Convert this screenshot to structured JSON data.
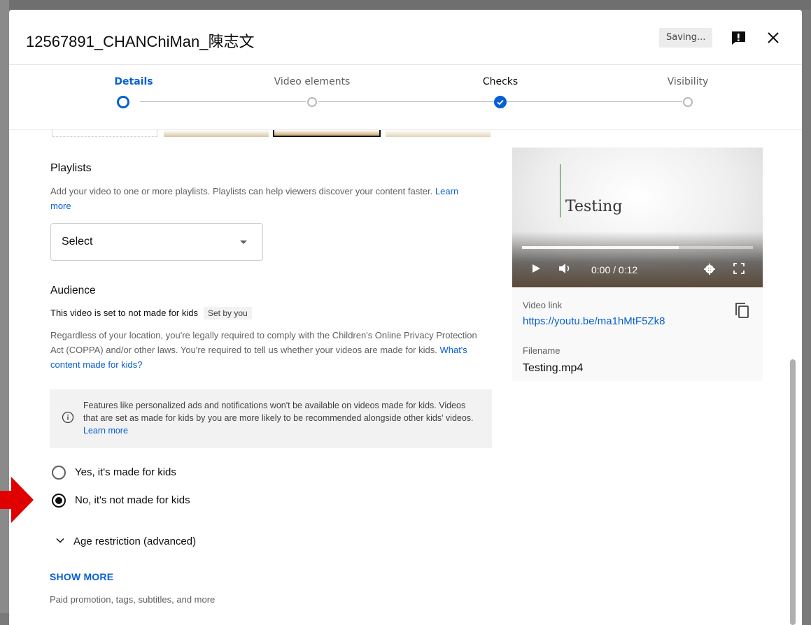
{
  "dialog": {
    "title": "12567891_CHANChiMan_陳志文",
    "saving_label": "Saving...",
    "feedback_icon": "feedback-icon",
    "close_icon": "close-icon"
  },
  "stepper": {
    "steps": [
      {
        "label": "Details",
        "state": "active"
      },
      {
        "label": "Video elements",
        "state": "todo"
      },
      {
        "label": "Checks",
        "state": "done"
      },
      {
        "label": "Visibility",
        "state": "todo"
      }
    ]
  },
  "playlists": {
    "heading": "Playlists",
    "description": "Add your video to one or more playlists. Playlists can help viewers discover your content faster.",
    "learn_more": "Learn more",
    "select_label": "Select"
  },
  "audience": {
    "heading": "Audience",
    "status_text": "This video is set to not made for kids",
    "status_badge": "Set by you",
    "description": "Regardless of your location, you're legally required to comply with the Children's Online Privacy Protection Act (COPPA) and/or other laws. You're required to tell us whether your videos are made for kids.",
    "made_for_kids_link": "What's content made for kids?",
    "info_text": "Features like personalized ads and notifications won't be available on videos made for kids. Videos that are set as made for kids by you are more likely to be recommended alongside other kids' videos.",
    "info_learn_more": "Learn more",
    "options": [
      {
        "label": "Yes, it's made for kids",
        "checked": false
      },
      {
        "label": "No, it's not made for kids",
        "checked": true
      }
    ]
  },
  "age_restriction": {
    "label": "Age restriction (advanced)"
  },
  "more": {
    "show_more": "SHOW MORE",
    "subtitle": "Paid promotion, tags, subtitles, and more"
  },
  "video": {
    "player_title": "Testing",
    "time": "0:00 / 0:12",
    "progress": 0.68,
    "link_label": "Video link",
    "link_url": "https://youtu.be/ma1hMtF5Zk8",
    "filename_label": "Filename",
    "filename": "Testing.mp4"
  },
  "colors": {
    "accent": "#065fd4",
    "annotation_arrow": "#e00000"
  }
}
